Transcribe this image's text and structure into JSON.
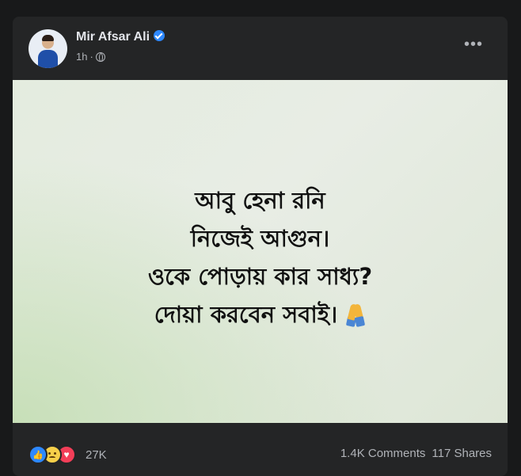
{
  "post": {
    "author": "Mir Afsar Ali",
    "verified": true,
    "time": "1h",
    "separator": "·",
    "privacy_icon": "globe-icon",
    "more_icon": "more-options-icon",
    "more_label": "•••"
  },
  "image": {
    "lines": [
      "আবু হেনা রনি",
      "নিজেই আগুন।",
      "ওকে পোড়ায় কার সাধ্য?",
      "দোয়া করবেন সবাই।"
    ],
    "emoji": "folded-hands-icon",
    "background": "#e6ebe2"
  },
  "footer": {
    "reaction_icons": [
      "like-icon",
      "sad-icon",
      "love-icon"
    ],
    "reaction_count": "27K",
    "comments": "1.4K Comments",
    "shares": "117 Shares"
  },
  "colors": {
    "page_bg": "#18191a",
    "card_bg": "#242526",
    "text_primary": "#e4e6eb",
    "text_secondary": "#b0b3b8",
    "accent": "#2d88ff"
  }
}
